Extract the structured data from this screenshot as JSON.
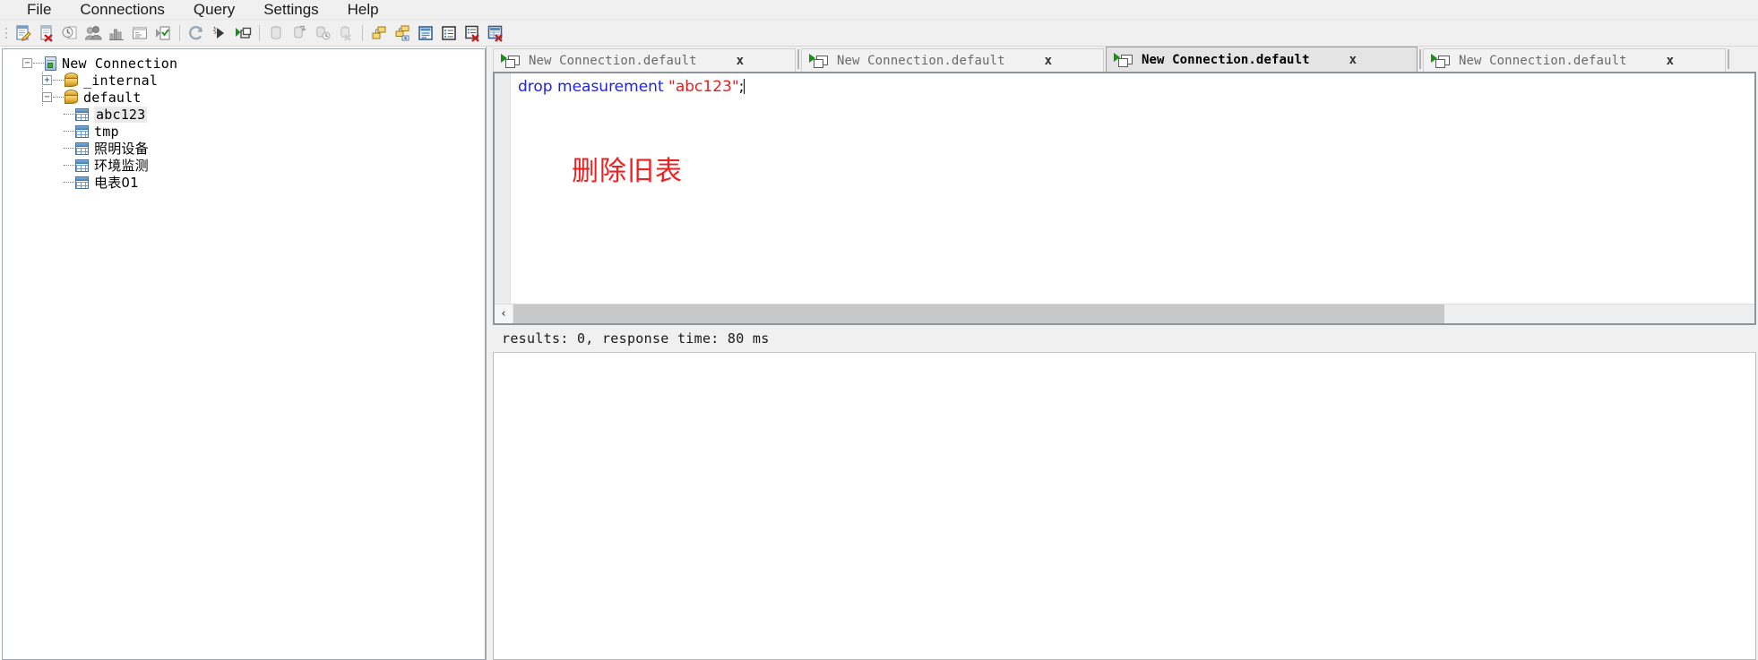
{
  "menubar": {
    "items": [
      {
        "label": "File",
        "name": "menu-file"
      },
      {
        "label": "Connections",
        "name": "menu-connections"
      },
      {
        "label": "Query",
        "name": "menu-query"
      },
      {
        "label": "Settings",
        "name": "menu-settings"
      },
      {
        "label": "Help",
        "name": "menu-help"
      }
    ]
  },
  "toolbar": {
    "groups": [
      {
        "buttons": [
          {
            "icon": "new-query-icon",
            "name": "toolbar-new-query"
          },
          {
            "icon": "delete-query-icon",
            "name": "toolbar-delete-query"
          },
          {
            "icon": "query-history-icon",
            "name": "toolbar-query-history"
          },
          {
            "icon": "users-icon",
            "name": "toolbar-users"
          },
          {
            "icon": "chart-icon",
            "name": "toolbar-chart"
          },
          {
            "icon": "console-icon",
            "name": "toolbar-console"
          },
          {
            "icon": "run-script-icon",
            "name": "toolbar-run-script"
          }
        ]
      },
      {
        "buttons": [
          {
            "icon": "refresh-icon",
            "name": "toolbar-refresh"
          },
          {
            "icon": "run-query-icon",
            "name": "toolbar-run-query"
          },
          {
            "icon": "run-all-icon",
            "name": "toolbar-run-all"
          }
        ]
      },
      {
        "buttons": [
          {
            "icon": "database-icon",
            "name": "toolbar-database"
          },
          {
            "icon": "database-transfer-icon",
            "name": "toolbar-database-transfer"
          },
          {
            "icon": "database-time-icon",
            "name": "toolbar-retention-policy"
          },
          {
            "icon": "database-delete-icon",
            "name": "toolbar-drop-database"
          }
        ]
      },
      {
        "buttons": [
          {
            "icon": "series-icon",
            "name": "toolbar-series"
          },
          {
            "icon": "series-info-icon",
            "name": "toolbar-series-info"
          },
          {
            "icon": "measurement-icon",
            "name": "toolbar-measurement"
          },
          {
            "icon": "field-list-icon",
            "name": "toolbar-field-list"
          },
          {
            "icon": "field-delete-icon",
            "name": "toolbar-drop-field"
          },
          {
            "icon": "table-delete-icon",
            "name": "toolbar-drop-measurement"
          }
        ]
      }
    ]
  },
  "tree": {
    "root": {
      "label": "New Connection",
      "icon": "server-icon",
      "expander": "−",
      "expanded": true
    },
    "databases": [
      {
        "label": "_internal",
        "icon": "database-icon",
        "expander": "+",
        "expanded": false,
        "tables": []
      },
      {
        "label": "default",
        "icon": "database-icon",
        "expander": "−",
        "expanded": true,
        "tables": [
          {
            "label": "abc123",
            "icon": "table-icon",
            "selected": true,
            "cjk": false
          },
          {
            "label": "tmp",
            "icon": "table-icon",
            "selected": false,
            "cjk": false
          },
          {
            "label": "照明设备",
            "icon": "table-icon",
            "selected": false,
            "cjk": true
          },
          {
            "label": "环境监测",
            "icon": "table-icon",
            "selected": false,
            "cjk": true
          },
          {
            "label": "电表01",
            "icon": "table-icon",
            "selected": false,
            "cjk": true
          }
        ]
      }
    ]
  },
  "tabs": {
    "items": [
      {
        "label": "New Connection.default",
        "close": "x",
        "active": false,
        "name": "tab-connection-1"
      },
      {
        "label": "New Connection.default",
        "close": "x",
        "active": false,
        "name": "tab-connection-2"
      },
      {
        "label": "New Connection.default",
        "close": "x",
        "active": true,
        "name": "tab-connection-3"
      },
      {
        "label": "New Connection.default",
        "close": "x",
        "active": false,
        "name": "tab-connection-4"
      }
    ]
  },
  "editor": {
    "query": {
      "keyword": "drop measurement ",
      "string": "\"abc123\"",
      "punct": ";"
    },
    "annotation": "删除旧表",
    "annotation_color": "#f02020",
    "keyword_color": "#2222dd",
    "string_color": "#e02020",
    "scrollbar": {
      "left_arrow": "‹",
      "thumb_percent": "75"
    }
  },
  "status": {
    "text": "results: 0, response time: 80 ms"
  },
  "results": {
    "rows": []
  }
}
